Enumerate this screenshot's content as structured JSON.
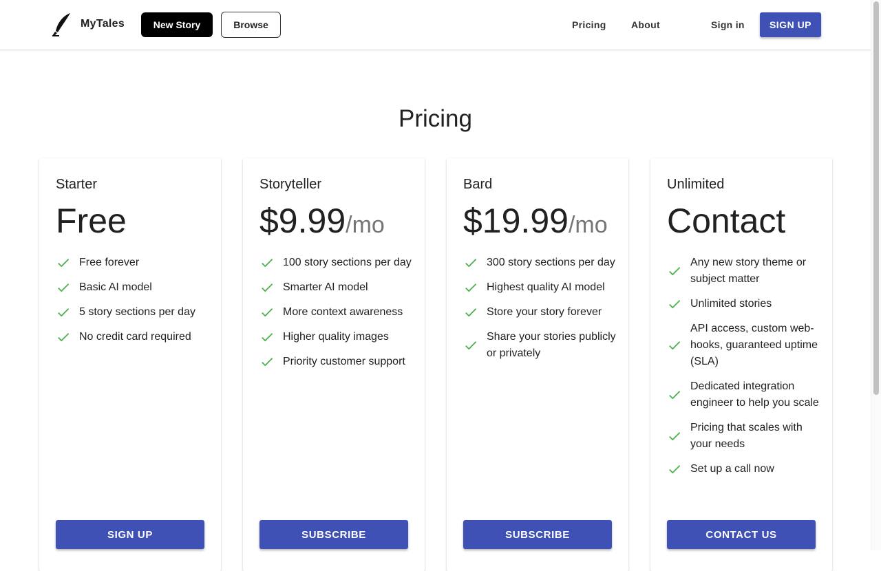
{
  "header": {
    "brand": "MyTales",
    "new_story": "New Story",
    "browse": "Browse",
    "nav": {
      "pricing": "Pricing",
      "about": "About",
      "sign_in": "Sign in",
      "sign_up": "SIGN UP"
    }
  },
  "page_title": "Pricing",
  "colors": {
    "primary": "#3f51b5",
    "check": "#4caf50",
    "black": "#000000"
  },
  "icons": {
    "logo": "quill-icon",
    "feature": "check-icon"
  },
  "plans": [
    {
      "name": "Starter",
      "price": "Free",
      "unit": "",
      "features": [
        "Free forever",
        "Basic AI model",
        "5 story sections per day",
        "No credit card required"
      ],
      "button": "SIGN UP"
    },
    {
      "name": "Storyteller",
      "price": "$9.99",
      "unit": "/mo",
      "features": [
        "100 story sections per day",
        "Smarter AI model",
        "More context awareness",
        "Higher quality images",
        "Priority customer support"
      ],
      "button": "SUBSCRIBE"
    },
    {
      "name": "Bard",
      "price": "$19.99",
      "unit": "/mo",
      "features": [
        "300 story sections per day",
        "Highest quality AI model",
        "Store your story forever",
        "Share your stories publicly or privately"
      ],
      "button": "SUBSCRIBE"
    },
    {
      "name": "Unlimited",
      "price": "Contact",
      "unit": "",
      "features": [
        "Any new story theme or subject matter",
        "Unlimited stories",
        "API access, custom web-hooks, guaranteed uptime (SLA)",
        "Dedicated integration engineer to help you scale",
        "Pricing that scales with your needs",
        "Set up a call now"
      ],
      "button": "CONTACT US"
    }
  ]
}
